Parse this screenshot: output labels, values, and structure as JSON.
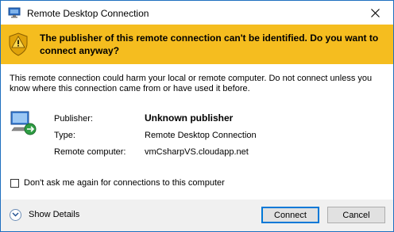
{
  "window": {
    "title": "Remote Desktop Connection"
  },
  "banner": {
    "message": "The publisher of this remote connection can't be identified. Do you want to connect anyway?",
    "icon": "warning-shield-icon",
    "color": "#f5bd1f"
  },
  "description": "This remote connection could harm your local or remote computer. Do not connect unless you know where this connection came from or have used it before.",
  "details": {
    "publisher_label": "Publisher:",
    "publisher_value": "Unknown publisher",
    "type_label": "Type:",
    "type_value": "Remote Desktop Connection",
    "computer_label": "Remote computer:",
    "computer_value": "vmCsharpVS.cloudapp.net"
  },
  "checkbox": {
    "label": "Don't ask me again for connections to this computer",
    "checked": false
  },
  "footer": {
    "show_details_label": "Show Details",
    "connect_label": "Connect",
    "cancel_label": "Cancel"
  }
}
